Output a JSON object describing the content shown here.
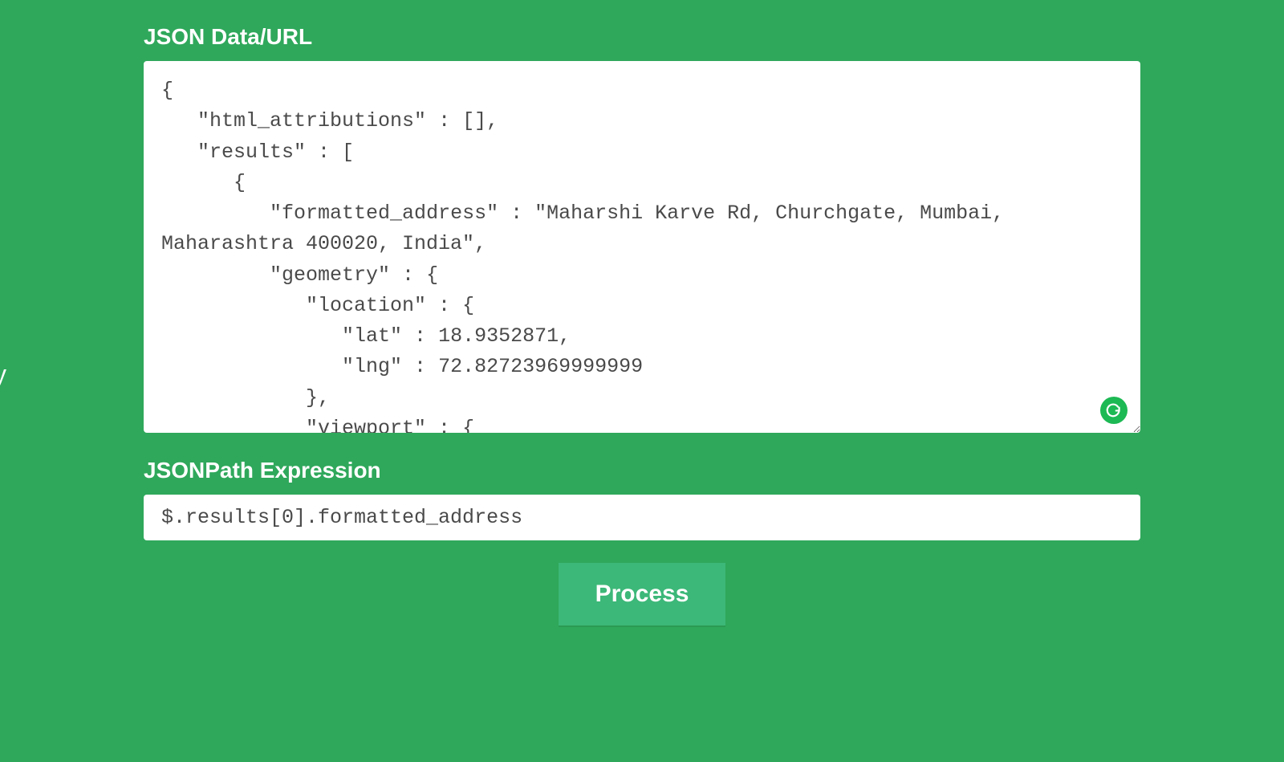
{
  "labels": {
    "json_data": "JSON Data/URL",
    "jsonpath": "JSONPath Expression"
  },
  "json_textarea_value": "{\n   \"html_attributions\" : [],\n   \"results\" : [\n      {\n         \"formatted_address\" : \"Maharshi Karve Rd, Churchgate, Mumbai, Maharashtra 400020, India\",\n         \"geometry\" : {\n            \"location\" : {\n               \"lat\" : 18.9352871,\n               \"lng\" : 72.82723969999999\n            },\n            \"viewport\" : {",
  "jsonpath_value": "$.results[0].formatted_address",
  "process_button_label": "Process",
  "side_letter": "y"
}
